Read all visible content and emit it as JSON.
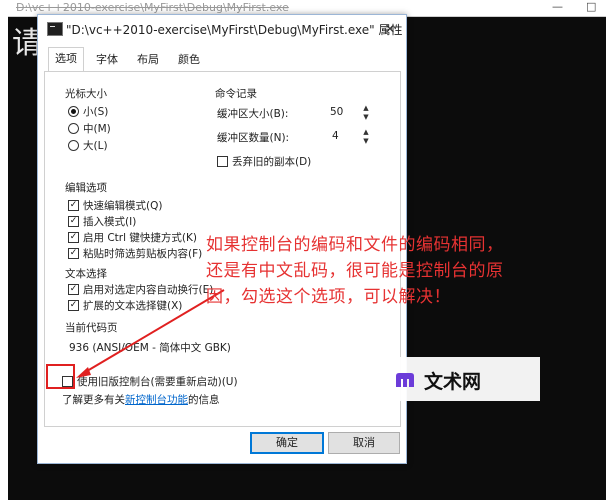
{
  "console": {
    "title": "D:\\vc++2010-exercise\\MyFirst\\Debug\\MyFirst.exe",
    "glyph": "请",
    "controls": [
      "—",
      "□"
    ]
  },
  "dialog": {
    "title": "\"D:\\vc++2010-exercise\\MyFirst\\Debug\\MyFirst.exe\" 属性",
    "close_label": "×",
    "tabs": [
      "选项",
      "字体",
      "布局",
      "颜色"
    ],
    "active_tab": "选项",
    "cursor_size": {
      "heading": "光标大小",
      "options": [
        "小(S)",
        "中(M)",
        "大(L)"
      ],
      "selected": "小(S)"
    },
    "command_history": {
      "heading": "命令记录",
      "buffer_size_label": "缓冲区大小(B):",
      "buffer_size_value": "50",
      "buffer_count_label": "缓冲区数量(N):",
      "buffer_count_value": "4",
      "discard_old_label": "丢弃旧的副本(D)",
      "discard_old_checked": false
    },
    "edit_options": {
      "heading": "编辑选项",
      "items": [
        {
          "label": "快速编辑模式(Q)",
          "checked": true
        },
        {
          "label": "插入模式(I)",
          "checked": true
        },
        {
          "label": "启用 Ctrl 键快捷方式(K)",
          "checked": true
        },
        {
          "label": "粘贴时筛选剪贴板内容(F)",
          "checked": true
        }
      ]
    },
    "text_selection": {
      "heading": "文本选择",
      "items": [
        {
          "label": "启用对选定内容自动换行(E)",
          "checked": true
        },
        {
          "label": "扩展的文本选择键(X)",
          "checked": true
        }
      ]
    },
    "codepage": {
      "heading": "当前代码页",
      "value": "936   (ANSI/OEM - 简体中文 GBK)"
    },
    "legacy_console": {
      "label": "使用旧版控制台(需要重新启动)(U)",
      "checked": false
    },
    "learn_more": {
      "prefix": "了解更多有关",
      "link": "新控制台功能",
      "suffix": "的信息"
    },
    "ok_label": "确定",
    "cancel_label": "取消"
  },
  "annotation": {
    "lines": [
      "如果控制台的编码和文件的编码相同，",
      "还是有中文乱码，很可能是控制台的原",
      "因，勾选这个选项，可以解决！"
    ],
    "color": "#e63232"
  },
  "watermark": {
    "text": "文术网",
    "logo_color": "#6c3cd9"
  }
}
